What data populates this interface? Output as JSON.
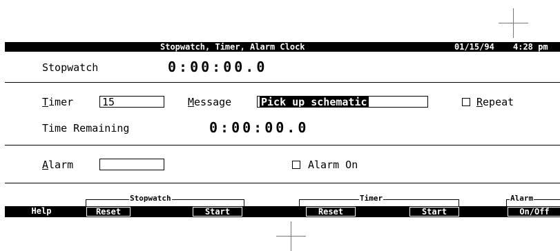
{
  "titlebar": {
    "title": "Stopwatch, Timer, Alarm Clock",
    "date": "01/15/94",
    "time": "4:28 pm"
  },
  "stopwatch": {
    "label": "Stopwatch",
    "display": "0:00:00.0"
  },
  "timer": {
    "label_first": "T",
    "label_rest": "imer",
    "value": "15",
    "message_label_first": "M",
    "message_label_rest": "essage",
    "message_value": "Pick up schematic",
    "repeat_label_first": "R",
    "repeat_label_rest": "epeat",
    "repeat_checked": false,
    "remaining_label": "Time Remaining",
    "remaining_display": "0:00:00.0"
  },
  "alarm": {
    "label_first": "A",
    "label_rest": "larm",
    "value": "",
    "on_label": "Alarm On",
    "on_checked": false
  },
  "function_keys": {
    "groups": {
      "stopwatch": "Stopwatch",
      "timer": "Timer",
      "alarm": "Alarm"
    },
    "keys": {
      "help": "Help",
      "stopwatch_reset": "Reset",
      "stopwatch_start": "Start",
      "timer_reset": "Reset",
      "timer_start": "Start",
      "alarm_onoff": "On/Off"
    }
  }
}
